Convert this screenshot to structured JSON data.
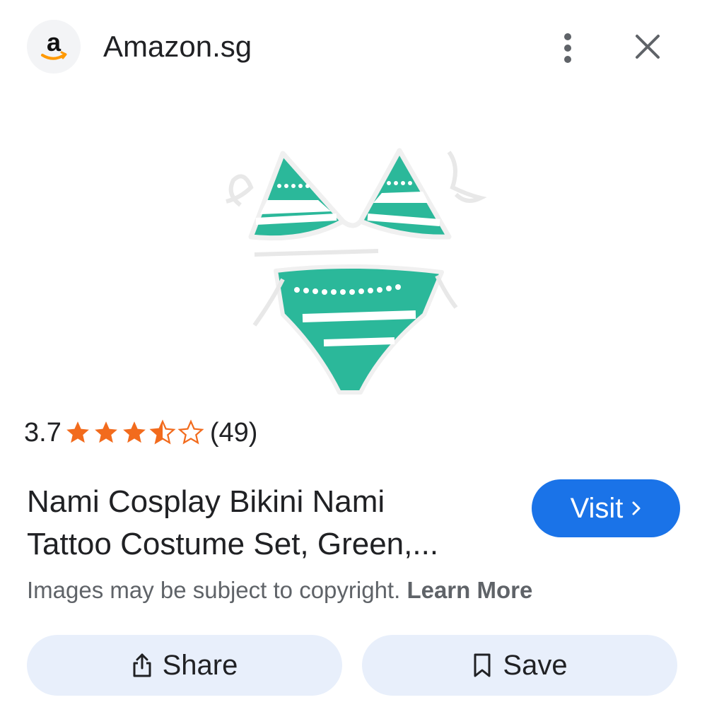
{
  "header": {
    "logo_letter": "a",
    "site_name": "Amazon.sg"
  },
  "product": {
    "rating_value": "3.7",
    "rating": 3.7,
    "rating_max": 5,
    "rating_count": "(49)",
    "title_line1": "Nami Cosplay Bikini Nami",
    "title_line2": "Tattoo Costume Set, Green,...",
    "image_description_colors": {
      "teal": "#2bb89a",
      "white": "#ffffff"
    }
  },
  "actions": {
    "visit_label": "Visit",
    "share_label": "Share",
    "save_label": "Save"
  },
  "notice": {
    "text": "Images may be subject to copyright. ",
    "link": "Learn More"
  },
  "colors": {
    "star": "#f26b1d",
    "visit_button": "#1a73e8",
    "secondary_button": "#e8effb",
    "text": "#202124",
    "muted_text": "#5f6368"
  },
  "icons": {
    "more": "more-vert-icon",
    "close": "close-icon",
    "share": "share-icon",
    "save": "bookmark-icon",
    "visit": "chevron-right-icon"
  }
}
